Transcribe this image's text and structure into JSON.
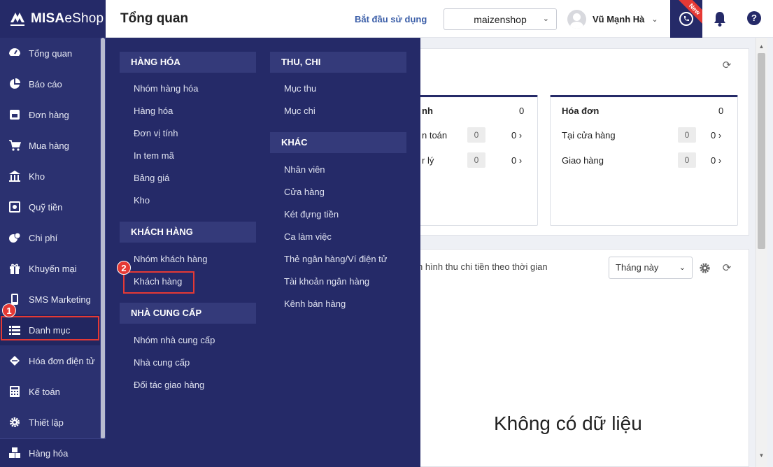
{
  "app": {
    "logo_bold": "MISA",
    "logo_rest": "eShop",
    "page_title": "Tổng quan"
  },
  "header": {
    "start_link": "Bắt đầu sử dụng",
    "shop": "maizenshop",
    "user_name": "Vũ Mạnh Hà",
    "new_badge": "New",
    "help": "?"
  },
  "sidebar": {
    "items": [
      {
        "label": "Tổng quan",
        "icon": "dashboard-icon"
      },
      {
        "label": "Báo cáo",
        "icon": "pie-chart-icon"
      },
      {
        "label": "Đơn hàng",
        "icon": "order-icon"
      },
      {
        "label": "Mua hàng",
        "icon": "cart-icon"
      },
      {
        "label": "Kho",
        "icon": "warehouse-icon"
      },
      {
        "label": "Quỹ tiền",
        "icon": "safe-icon"
      },
      {
        "label": "Chi phí",
        "icon": "expense-icon"
      },
      {
        "label": "Khuyến mại",
        "icon": "gift-icon"
      },
      {
        "label": "SMS Marketing",
        "icon": "phone-icon"
      },
      {
        "label": "Danh mục",
        "icon": "list-icon"
      },
      {
        "label": "Hóa đơn điện tử",
        "icon": "invoice-icon"
      },
      {
        "label": "Kế toán",
        "icon": "calculator-icon"
      },
      {
        "label": "Thiết lập",
        "icon": "gear-icon"
      }
    ],
    "bottom": {
      "label": "Hàng hóa",
      "icon": "boxes-icon"
    }
  },
  "callouts": {
    "one": "1",
    "two": "2"
  },
  "megamenu": {
    "col1": {
      "goods_header": "HÀNG HÓA",
      "goods": [
        "Nhóm hàng hóa",
        "Hàng hóa",
        "Đơn vị tính",
        "In tem mã",
        "Bảng giá",
        "Kho"
      ],
      "customer_header": "KHÁCH HÀNG",
      "customers": [
        "Nhóm khách hàng",
        "Khách hàng"
      ],
      "supplier_header": "NHÀ CUNG CẤP",
      "suppliers": [
        "Nhóm nhà cung cấp",
        "Nhà cung cấp",
        "Đối tác giao hàng"
      ]
    },
    "col2": {
      "income_header": "THU, CHI",
      "income": [
        "Mục thu",
        "Mục chi"
      ],
      "other_header": "KHÁC",
      "other": [
        "Nhân viên",
        "Cửa hàng",
        "Két đựng tiền",
        "Ca làm việc",
        "Thẻ ngân hàng/Ví điện tử",
        "Tài khoản ngân hàng",
        "Kênh bán hàng"
      ]
    }
  },
  "dashboard": {
    "card_left": {
      "title_partial": "nh",
      "total": "0",
      "rows": [
        {
          "label": "n toán",
          "count": "0",
          "value": "0 ›"
        },
        {
          "label": "r lý",
          "count": "0",
          "value": "0 ›"
        }
      ]
    },
    "card_invoice": {
      "title": "Hóa đơn",
      "total": "0",
      "rows": [
        {
          "label": "Tại cửa hàng",
          "count": "0",
          "value": "0 ›"
        },
        {
          "label": "Giao hàng",
          "count": "0",
          "value": "0 ›"
        }
      ]
    },
    "chart_title_partial": "h hình thu chi tiền theo thời gian",
    "period": "Tháng này",
    "empty": "Không có dữ liệu"
  }
}
